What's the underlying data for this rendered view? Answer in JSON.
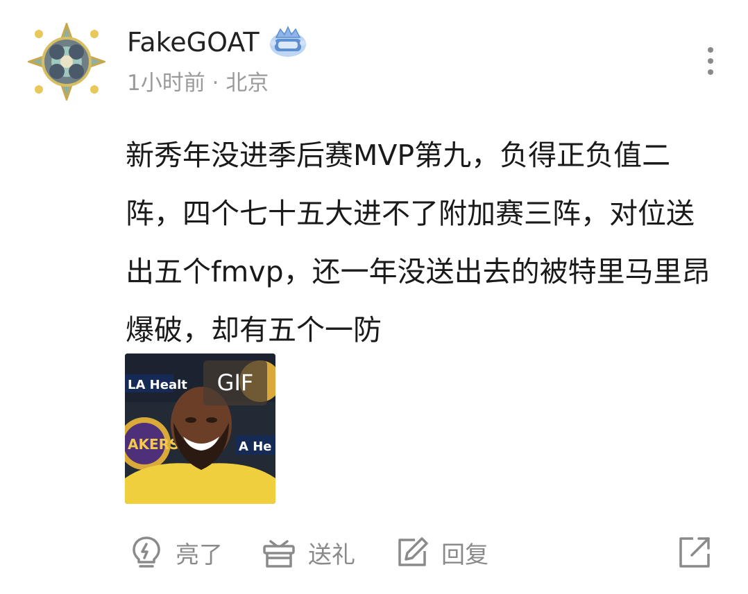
{
  "post": {
    "username": "FakeGOAT",
    "time": "1小时前",
    "separator": "·",
    "location": "北京",
    "content": "新秀年没进季后赛MVP第九，负得正负值二阵，四个七十五大进不了附加赛三阵，对位送出五个fmvp，还一年没送出去的被特里马里昂爆破，却有五个一防",
    "gif_label": "GIF",
    "gif_text_left": "LA Healt",
    "gif_text_right": "A He",
    "gif_logo_text": "AKERS"
  },
  "actions": {
    "light_label": "亮了",
    "gift_label": "送礼",
    "reply_label": "回复"
  },
  "icons": {
    "avatar": "ornament-avatar-icon",
    "badge": "crown-badge-icon",
    "more": "more-vertical-icon",
    "light": "lightbulb-icon",
    "gift": "gift-icon",
    "reply": "edit-icon",
    "share": "share-icon"
  },
  "colors": {
    "text": "#1a1a1a",
    "muted": "#9a9a9a",
    "icon": "#8a8a8a"
  }
}
